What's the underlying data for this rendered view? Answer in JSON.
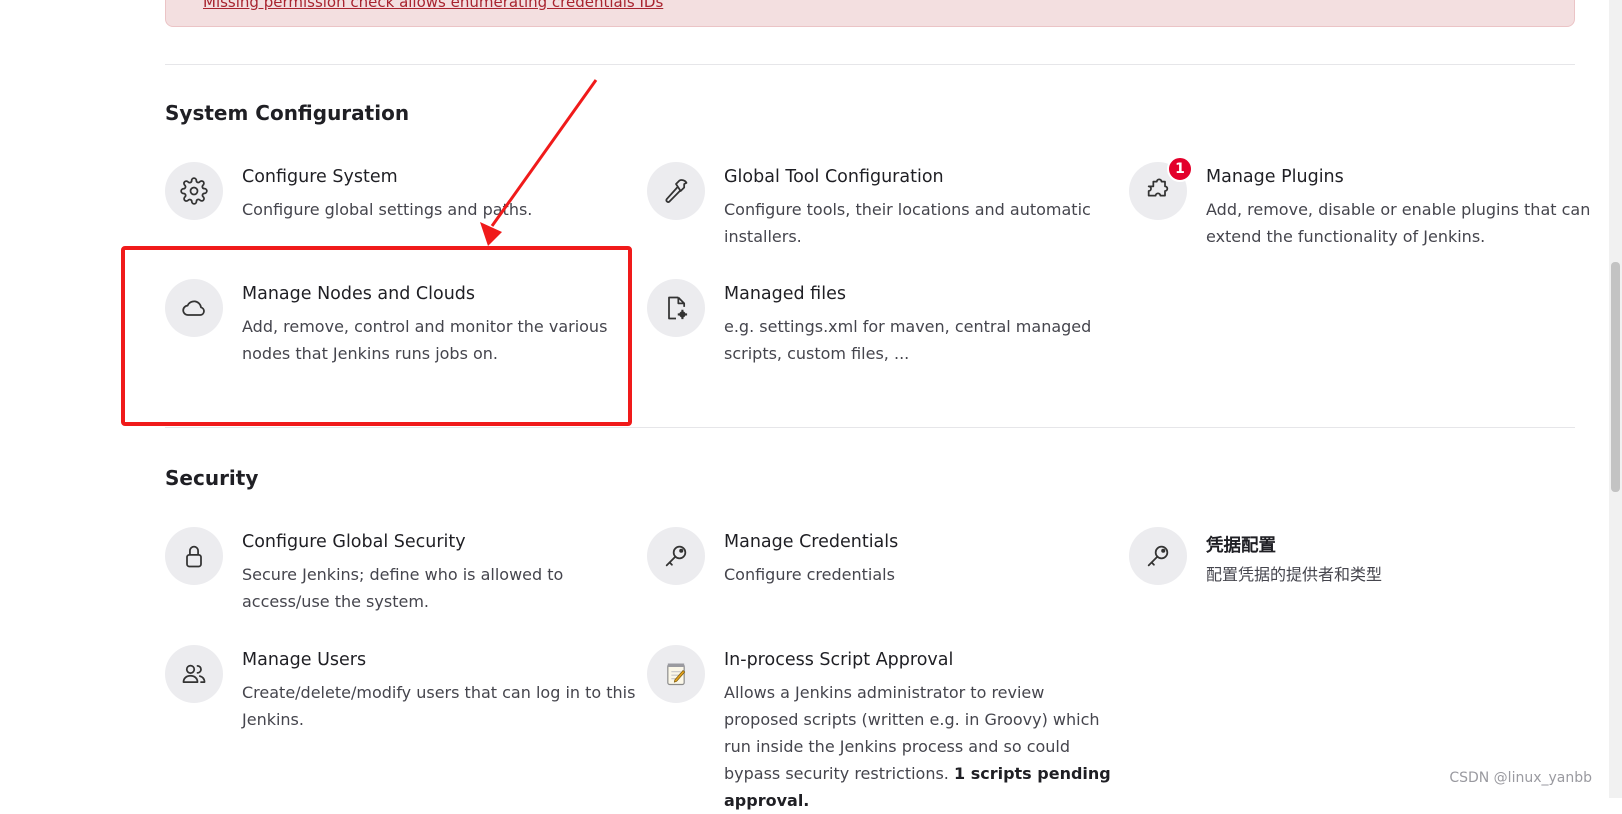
{
  "alert": {
    "link_text": "Missing permission check allows enumerating credentials IDs"
  },
  "sections": {
    "system": {
      "title": "System Configuration",
      "items": [
        {
          "title": "Configure System",
          "desc": "Configure global settings and paths.",
          "icon": "gear-icon"
        },
        {
          "title": "Global Tool Configuration",
          "desc": "Configure tools, their locations and automatic installers.",
          "icon": "hammer-icon"
        },
        {
          "title": "Manage Plugins",
          "desc": "Add, remove, disable or enable plugins that can extend the functionality of Jenkins.",
          "icon": "puzzle-icon",
          "badge": "1"
        },
        {
          "title": "Manage Nodes and Clouds",
          "desc": "Add, remove, control and monitor the various nodes that Jenkins runs jobs on.",
          "icon": "cloud-icon"
        },
        {
          "title": "Managed files",
          "desc": "e.g. settings.xml for maven, central managed scripts, custom files, ...",
          "icon": "file-gear-icon"
        }
      ]
    },
    "security": {
      "title": "Security",
      "items": [
        {
          "title": "Configure Global Security",
          "desc": "Secure Jenkins; define who is allowed to access/use the system.",
          "icon": "lock-icon"
        },
        {
          "title": "Manage Credentials",
          "desc": "Configure credentials",
          "icon": "key-icon"
        },
        {
          "title": "凭据配置",
          "desc": "配置凭据的提供者和类型",
          "icon": "key-icon"
        },
        {
          "title": "Manage Users",
          "desc": "Create/delete/modify users that can log in to this Jenkins.",
          "icon": "users-icon"
        },
        {
          "title": "In-process Script Approval",
          "desc": "Allows a Jenkins administrator to review proposed scripts (written e.g. in Groovy) which run inside the Jenkins process and so could bypass security restrictions.",
          "pending": "1 scripts pending approval.",
          "icon": "notepad-icon"
        }
      ]
    }
  },
  "watermark": "CSDN @linux_yanbb",
  "colors": {
    "highlight": "#f01a1a",
    "badge": "#e3002b",
    "alert_bg": "#f3dfe0",
    "alert_link": "#a8242f"
  }
}
